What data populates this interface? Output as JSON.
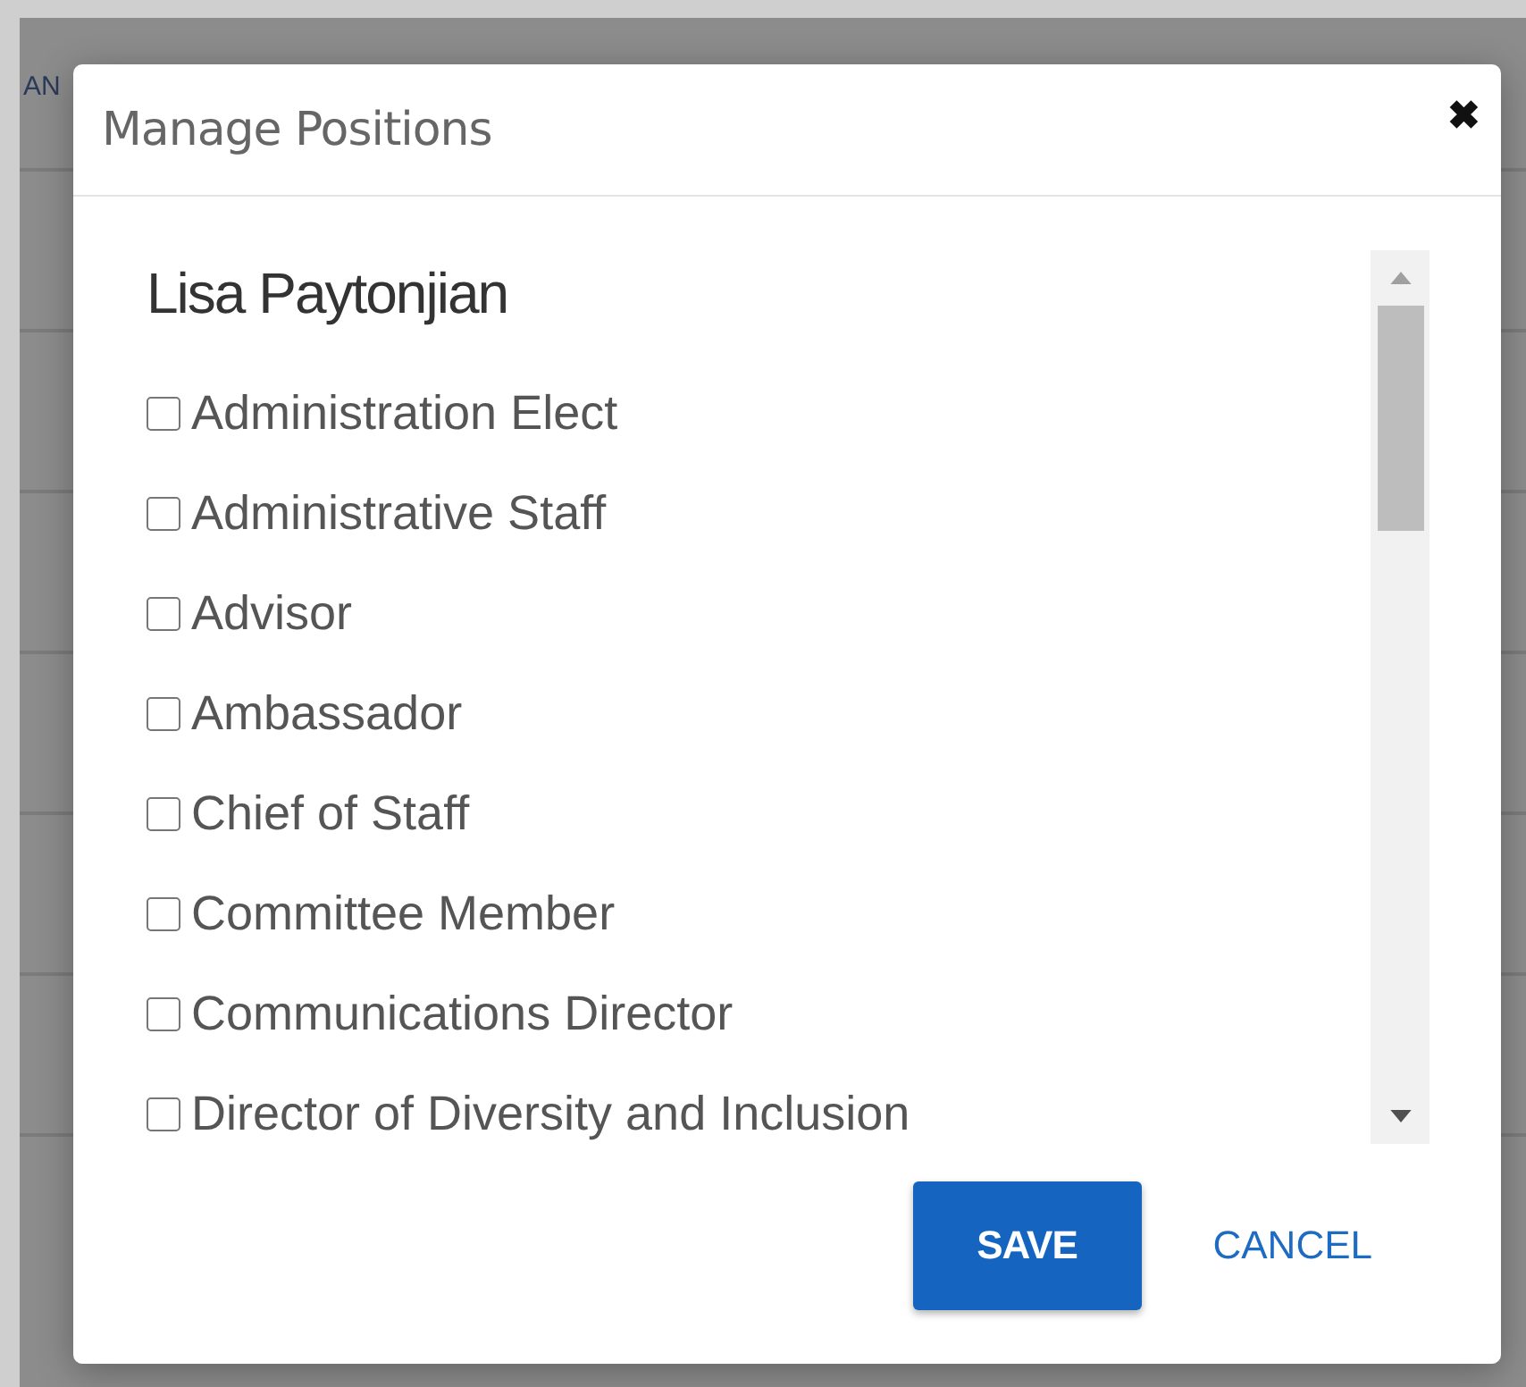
{
  "background_page": {
    "header_text": "AN"
  },
  "dialog": {
    "title": "Manage Positions",
    "close_icon": "✖",
    "person_name": "Lisa Paytonjian",
    "positions": [
      {
        "label": "Administration Elect",
        "checked": false
      },
      {
        "label": "Administrative Staff",
        "checked": false
      },
      {
        "label": "Advisor",
        "checked": false
      },
      {
        "label": "Ambassador",
        "checked": false
      },
      {
        "label": "Chief of Staff",
        "checked": false
      },
      {
        "label": "Committee Member",
        "checked": false
      },
      {
        "label": "Communications Director",
        "checked": false
      },
      {
        "label": "Director of Diversity and Inclusion",
        "checked": false
      }
    ],
    "buttons": [
      {
        "label": "SAVE",
        "kind": "primary"
      },
      {
        "label": "CANCEL",
        "kind": "flat"
      }
    ]
  }
}
